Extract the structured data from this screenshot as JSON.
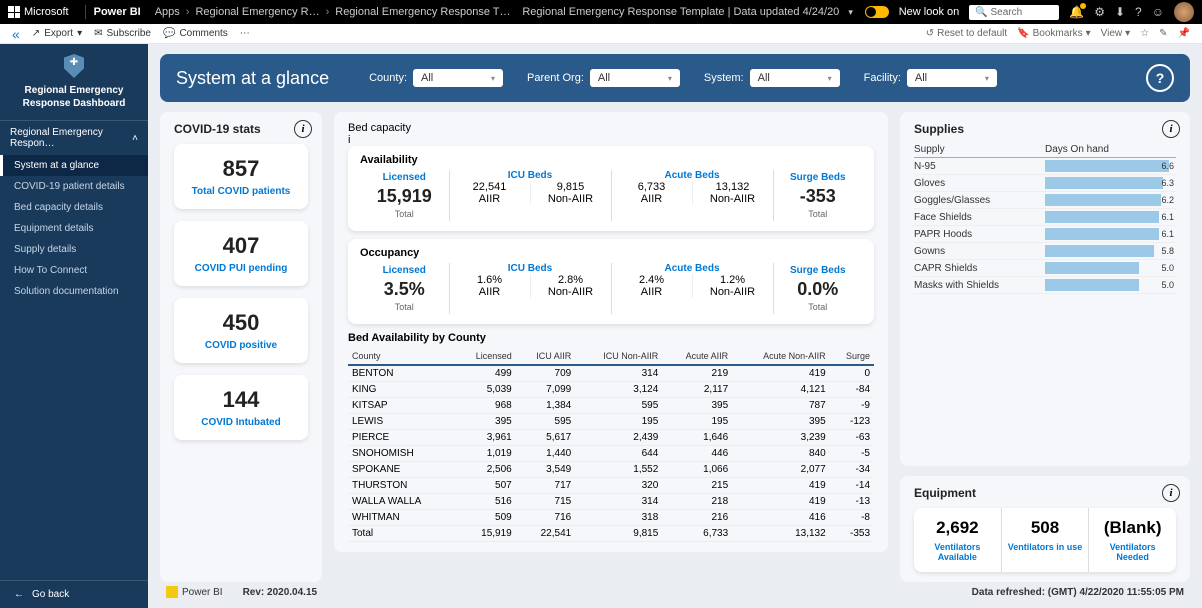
{
  "topbar": {
    "ms": "Microsoft",
    "product": "Power BI",
    "apps": "Apps",
    "crumb1": "Regional Emergency R…",
    "crumb2": "Regional Emergency Response T…",
    "center": "Regional Emergency Response Template | Data updated 4/24/20",
    "newlook": "New look on",
    "search_placeholder": "Search"
  },
  "actionbar": {
    "export": "Export",
    "subscribe": "Subscribe",
    "comments": "Comments",
    "reset": "Reset to default",
    "bookmarks": "Bookmarks",
    "view": "View"
  },
  "sidebar": {
    "title": "Regional Emergency Response Dashboard",
    "section": "Regional Emergency Respon…",
    "items": [
      "System at a glance",
      "COVID-19 patient details",
      "Bed capacity details",
      "Equipment details",
      "Supply details",
      "How To Connect",
      "Solution documentation"
    ],
    "goback": "Go back"
  },
  "header": {
    "title": "System at a glance",
    "filters": [
      {
        "label": "County:",
        "value": "All"
      },
      {
        "label": "Parent Org:",
        "value": "All"
      },
      {
        "label": "System:",
        "value": "All"
      },
      {
        "label": "Facility:",
        "value": "All"
      }
    ]
  },
  "covid": {
    "title": "COVID-19 stats",
    "tiles": [
      {
        "num": "857",
        "lbl": "Total COVID patients"
      },
      {
        "num": "407",
        "lbl": "COVID PUI pending"
      },
      {
        "num": "450",
        "lbl": "COVID positive"
      },
      {
        "num": "144",
        "lbl": "COVID Intubated"
      }
    ]
  },
  "bed": {
    "title": "Bed capacity",
    "avail_title": "Availability",
    "occ_title": "Occupancy",
    "lic": "Licensed",
    "icu": "ICU Beds",
    "acute": "Acute Beds",
    "surge": "Surge Beds",
    "total": "Total",
    "aiir": "AIIR",
    "nonaiir": "Non-AIIR",
    "avail": {
      "licensed": "15,919",
      "icu_a": "22,541",
      "icu_n": "9,815",
      "ac_a": "6,733",
      "ac_n": "13,132",
      "surge": "-353"
    },
    "occ": {
      "licensed": "3.5%",
      "icu_a": "1.6%",
      "icu_n": "2.8%",
      "ac_a": "2.4%",
      "ac_n": "1.2%",
      "surge": "0.0%"
    }
  },
  "county": {
    "title": "Bed Availability by County",
    "cols": [
      "County",
      "Licensed",
      "ICU AIIR",
      "ICU Non-AIIR",
      "Acute AIIR",
      "Acute Non-AIIR",
      "Surge"
    ],
    "rows": [
      [
        "BENTON",
        "499",
        "709",
        "314",
        "219",
        "419",
        "0"
      ],
      [
        "KING",
        "5,039",
        "7,099",
        "3,124",
        "2,117",
        "4,121",
        "-84"
      ],
      [
        "KITSAP",
        "968",
        "1,384",
        "595",
        "395",
        "787",
        "-9"
      ],
      [
        "LEWIS",
        "395",
        "595",
        "195",
        "195",
        "395",
        "-123"
      ],
      [
        "PIERCE",
        "3,961",
        "5,617",
        "2,439",
        "1,646",
        "3,239",
        "-63"
      ],
      [
        "SNOHOMISH",
        "1,019",
        "1,440",
        "644",
        "446",
        "840",
        "-5"
      ],
      [
        "SPOKANE",
        "2,506",
        "3,549",
        "1,552",
        "1,066",
        "2,077",
        "-34"
      ],
      [
        "THURSTON",
        "507",
        "717",
        "320",
        "215",
        "419",
        "-14"
      ],
      [
        "WALLA WALLA",
        "516",
        "715",
        "314",
        "218",
        "419",
        "-13"
      ],
      [
        "WHITMAN",
        "509",
        "716",
        "318",
        "216",
        "416",
        "-8"
      ]
    ],
    "total": [
      "Total",
      "15,919",
      "22,541",
      "9,815",
      "6,733",
      "13,132",
      "-353"
    ]
  },
  "supplies": {
    "title": "Supplies",
    "col1": "Supply",
    "col2": "Days On hand",
    "max": 7,
    "rows": [
      {
        "name": "N-95",
        "val": 6.6
      },
      {
        "name": "Gloves",
        "val": 6.3
      },
      {
        "name": "Goggles/Glasses",
        "val": 6.2
      },
      {
        "name": "Face Shields",
        "val": 6.1
      },
      {
        "name": "PAPR Hoods",
        "val": 6.1
      },
      {
        "name": "Gowns",
        "val": 5.8
      },
      {
        "name": "CAPR Shields",
        "val": 5.0
      },
      {
        "name": "Masks with Shields",
        "val": 5.0
      }
    ]
  },
  "equipment": {
    "title": "Equipment",
    "cells": [
      {
        "v": "2,692",
        "l": "Ventilators Available"
      },
      {
        "v": "508",
        "l": "Ventilators in use"
      },
      {
        "v": "(Blank)",
        "l": "Ventilators Needed"
      }
    ]
  },
  "chart_data": {
    "type": "bar",
    "title": "Supplies — Days On hand",
    "xlabel": "Days On hand",
    "ylabel": "Supply",
    "xlim": [
      0,
      7
    ],
    "categories": [
      "N-95",
      "Gloves",
      "Goggles/Glasses",
      "Face Shields",
      "PAPR Hoods",
      "Gowns",
      "CAPR Shields",
      "Masks with Shields"
    ],
    "values": [
      6.6,
      6.3,
      6.2,
      6.1,
      6.1,
      5.8,
      5.0,
      5.0
    ]
  },
  "footer": {
    "pbi": "Power BI",
    "rev": "Rev: 2020.04.15",
    "refreshed": "Data refreshed: (GMT)   4/22/2020 11:55:05 PM"
  }
}
